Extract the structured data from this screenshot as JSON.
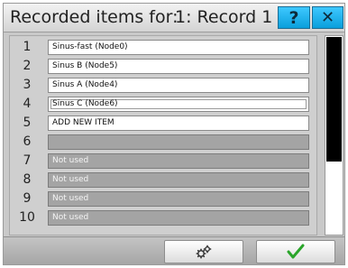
{
  "dialog": {
    "title_prefix": "Recorded items for:",
    "record_name": "1: Record 1",
    "help_label": "?",
    "close_label": "✕"
  },
  "items": [
    {
      "number": "1",
      "label": "Sinus-fast (Node0)",
      "state": "used"
    },
    {
      "number": "2",
      "label": "Sinus B (Node5)",
      "state": "used"
    },
    {
      "number": "3",
      "label": "Sinus A (Node4)",
      "state": "used"
    },
    {
      "number": "4",
      "label": "Sinus C (Node6)",
      "state": "used-focused"
    },
    {
      "number": "5",
      "label": "ADD NEW ITEM",
      "state": "add"
    },
    {
      "number": "6",
      "label": "",
      "state": "empty"
    },
    {
      "number": "7",
      "label": "Not used",
      "state": "empty"
    },
    {
      "number": "8",
      "label": "Not used",
      "state": "empty"
    },
    {
      "number": "9",
      "label": "Not used",
      "state": "empty"
    },
    {
      "number": "10",
      "label": "Not used",
      "state": "empty"
    }
  ],
  "icons": {
    "help": "help-icon",
    "close": "close-icon",
    "settings": "gears-icon",
    "confirm": "checkmark-icon"
  },
  "colors": {
    "accent": "#1ab0ec",
    "confirm_green": "#2aa52a",
    "used_field": "#ffffff",
    "empty_field": "#a4a4a4"
  }
}
